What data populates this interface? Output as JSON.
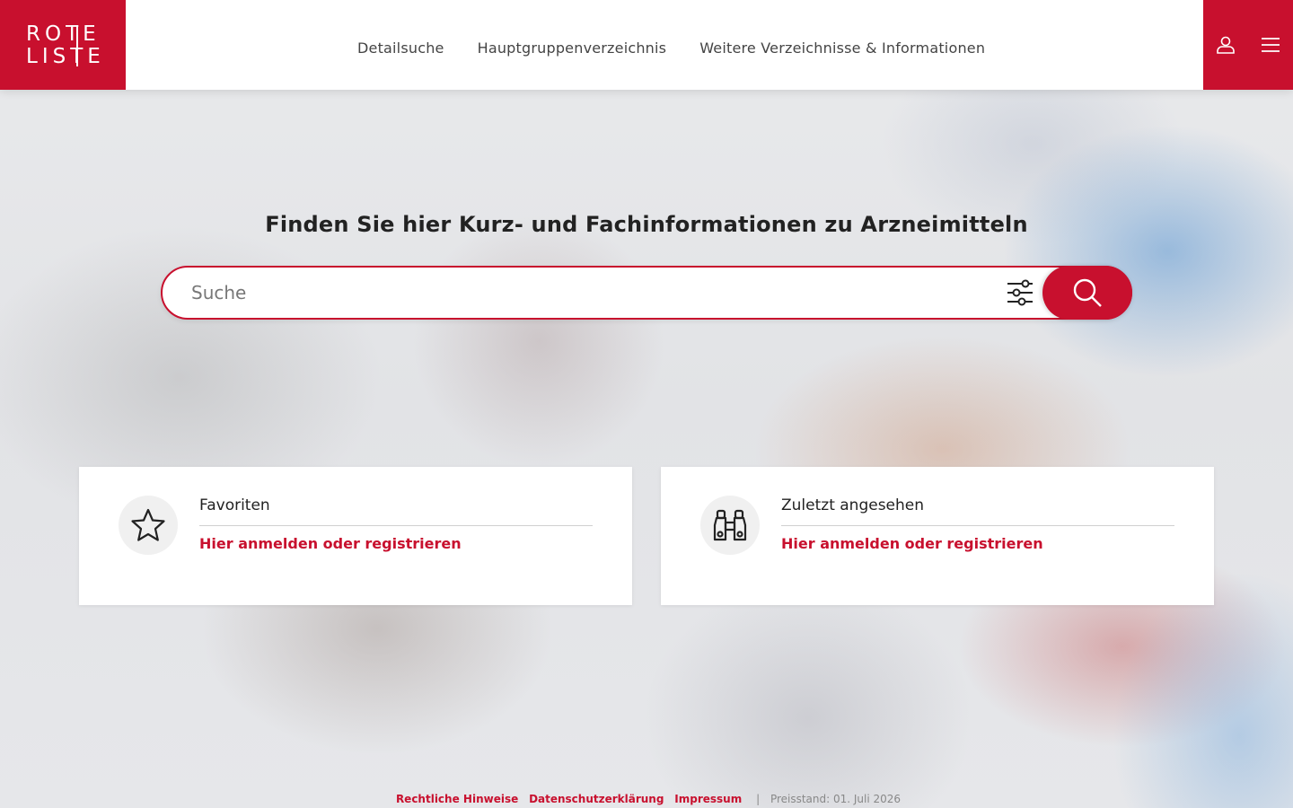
{
  "header": {
    "logo": {
      "line1": "ROTE",
      "line2": "LISTE"
    },
    "nav": [
      {
        "label": "Detailsuche"
      },
      {
        "label": "Hauptgruppenverzeichnis"
      },
      {
        "label": "Weitere Verzeichnisse & Informationen"
      }
    ],
    "actions": {
      "user_icon": "user-icon",
      "menu_icon": "hamburger-menu-icon"
    }
  },
  "hero": {
    "title": "Finden Sie hier Kurz- und Fachinformationen zu Arzneimitteln",
    "search": {
      "placeholder": "Suche",
      "value": "",
      "filter_icon": "sliders-icon",
      "submit_icon": "search-icon"
    }
  },
  "cards": [
    {
      "icon": "star-icon",
      "title": "Favoriten",
      "link": "Hier anmelden oder registrieren"
    },
    {
      "icon": "binoculars-icon",
      "title": "Zuletzt angesehen",
      "link": "Hier anmelden oder registrieren"
    }
  ],
  "footer": {
    "links": [
      "Rechtliche Hinweise",
      "Datenschutzerklärung",
      "Impressum"
    ],
    "separator": "|",
    "price_date": "Preisstand: 01. Juli 2026"
  },
  "colors": {
    "brand": "#c8102e",
    "text": "#222222",
    "card_bg": "#ffffff"
  }
}
